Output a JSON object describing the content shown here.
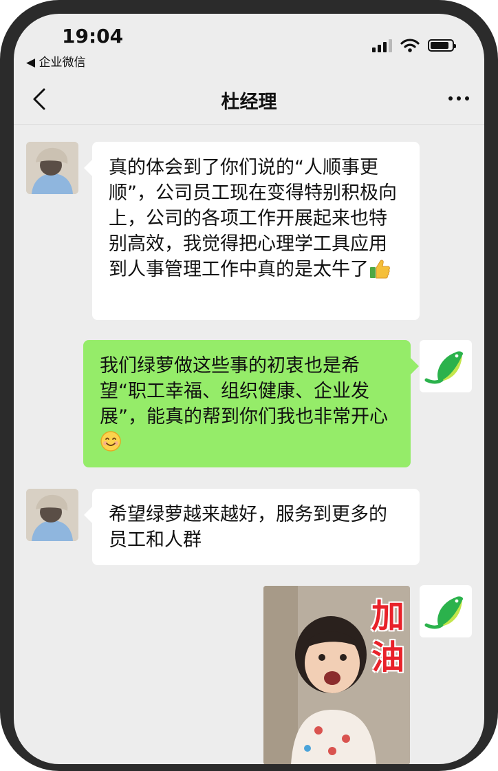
{
  "status_bar": {
    "time": "19:04",
    "back_app": "◀ 企业微信"
  },
  "navbar": {
    "title": "杜经理",
    "back_icon": "chevron-left-icon",
    "more_icon": "ellipsis-icon"
  },
  "messages": [
    {
      "sender": "杜经理",
      "direction": "in",
      "text": "真的体会到了你们说的“人顺事更顺”，公司员工现在变得特别积极向上，公司的各项工作开展起来也特别高效，我觉得把心理学工具应用到人事管理工作中真的是太牛了",
      "emoji": "thumbs-up-icon"
    },
    {
      "sender": "绿萝",
      "direction": "out",
      "text": "我们绿萝做这些事的初衷也是希望“职工幸福、组织健康、企业发展”，能真的帮到你们我也非常开心",
      "emoji": "smile-icon"
    },
    {
      "sender": "杜经理",
      "direction": "in",
      "text": "希望绿萝越来越好，服务到更多的员工和人群"
    },
    {
      "sender": "绿萝",
      "direction": "out",
      "type": "sticker",
      "sticker_text": "加油"
    }
  ],
  "colors": {
    "outgoing_bubble": "#95ec69",
    "incoming_bubble": "#ffffff",
    "chat_background": "#ededed",
    "sticker_text": "#e8222a"
  }
}
